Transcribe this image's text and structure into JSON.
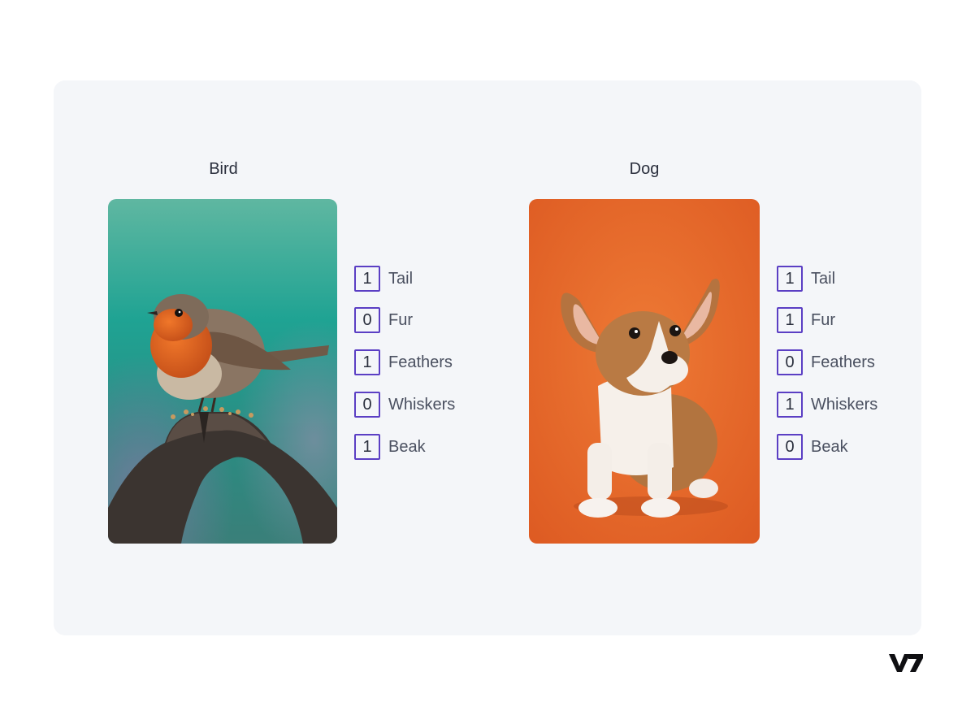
{
  "colors": {
    "panel_bg": "#f4f6f9",
    "box_border": "#5b3fc4",
    "label_text": "#4a5060"
  },
  "panels": [
    {
      "title": "Bird",
      "image": "robin-on-perch",
      "features": [
        {
          "value": "1",
          "label": "Tail"
        },
        {
          "value": "0",
          "label": "Fur"
        },
        {
          "value": "1",
          "label": "Feathers"
        },
        {
          "value": "0",
          "label": "Whiskers"
        },
        {
          "value": "1",
          "label": "Beak"
        }
      ]
    },
    {
      "title": "Dog",
      "image": "corgi-puppy",
      "features": [
        {
          "value": "1",
          "label": "Tail"
        },
        {
          "value": "1",
          "label": "Fur"
        },
        {
          "value": "0",
          "label": "Feathers"
        },
        {
          "value": "1",
          "label": "Whiskers"
        },
        {
          "value": "0",
          "label": "Beak"
        }
      ]
    }
  ],
  "brand": {
    "logo": "V7"
  }
}
